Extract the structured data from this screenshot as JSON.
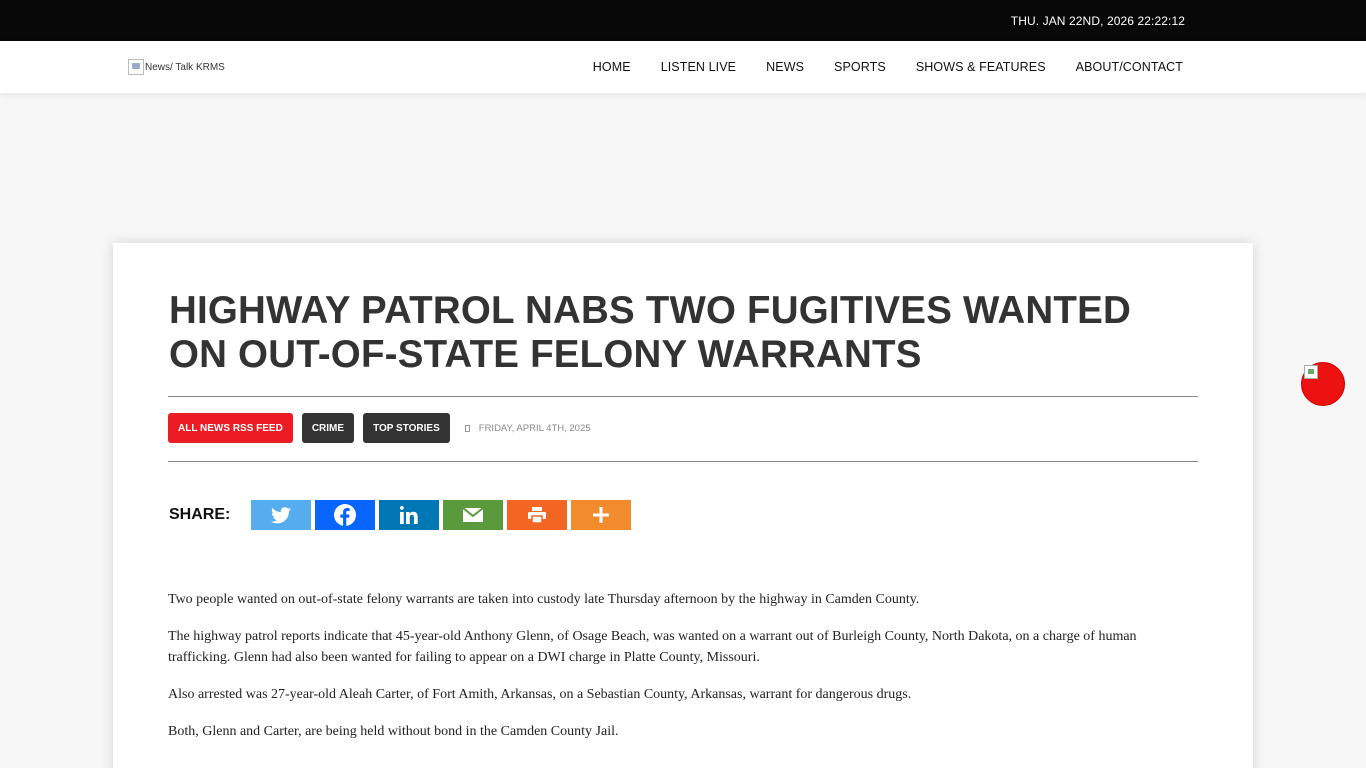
{
  "topbar": {
    "datetime": "THU. JAN 22ND, 2026 22:22:12"
  },
  "header": {
    "logo_alt": "News/ Talk KRMS",
    "nav": [
      {
        "label": "HOME"
      },
      {
        "label": "LISTEN LIVE"
      },
      {
        "label": "NEWS"
      },
      {
        "label": "SPORTS"
      },
      {
        "label": "SHOWS & FEATURES"
      },
      {
        "label": "ABOUT/CONTACT"
      }
    ]
  },
  "article": {
    "title": "HIGHWAY PATROL NABS TWO FUGITIVES WANTED ON OUT-OF-STATE FELONY WARRANTS",
    "tags": [
      {
        "label": "ALL NEWS RSS FEED",
        "color": "#ec1c24"
      },
      {
        "label": "CRIME",
        "color": "#333333"
      },
      {
        "label": "TOP STORIES",
        "color": "#333333"
      }
    ],
    "date": "FRIDAY, APRIL 4TH, 2025",
    "share_label": "SHARE:",
    "share_buttons": [
      {
        "icon": "twitter-icon",
        "color": "#55acee"
      },
      {
        "icon": "facebook-icon",
        "color": "#0866ff"
      },
      {
        "icon": "linkedin-icon",
        "color": "#0077b5"
      },
      {
        "icon": "email-icon",
        "color": "#5b9a3c"
      },
      {
        "icon": "print-icon",
        "color": "#f26522"
      },
      {
        "icon": "plus-icon",
        "color": "#f28b2c"
      }
    ],
    "paragraphs": [
      "Two people wanted on out-of-state felony warrants are taken into custody late Thursday afternoon by the highway in Camden County.",
      "The highway patrol reports indicate that 45-year-old Anthony Glenn, of Osage Beach, was wanted on a warrant out of Burleigh County, North Dakota, on a charge of human trafficking. Glenn had also been wanted for failing to appear on a DWI charge in Platte County, Missouri.",
      "Also arrested was 27-year-old Aleah Carter, of Fort Amith, Arkansas, on a Sebastian County, Arkansas, warrant for dangerous drugs.",
      "Both, Glenn and Carter, are being held without bond in the Camden County Jail."
    ]
  }
}
